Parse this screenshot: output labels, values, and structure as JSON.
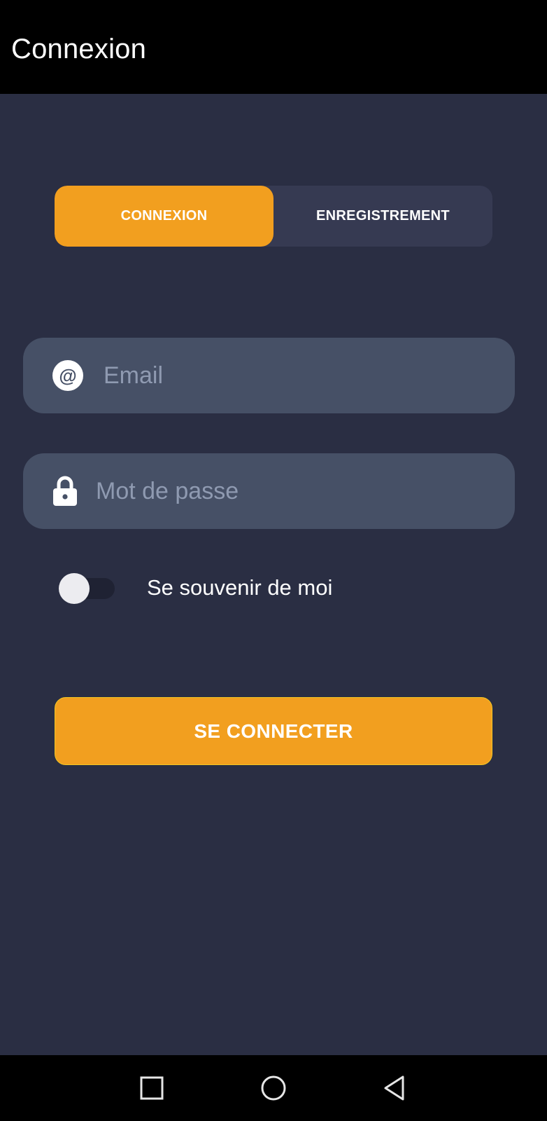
{
  "app_bar": {
    "title": "Connexion"
  },
  "tabs": [
    {
      "label": "CONNEXION",
      "active": true
    },
    {
      "label": "ENREGISTREMENT",
      "active": false
    }
  ],
  "form": {
    "email": {
      "placeholder": "Email",
      "value": "",
      "icon": "at-sign-icon"
    },
    "password": {
      "placeholder": "Mot de passe",
      "value": "",
      "icon": "lock-icon"
    },
    "remember_me": {
      "label": "Se souvenir de moi",
      "checked": false
    },
    "submit_label": "SE CONNECTER"
  },
  "nav": {
    "buttons": [
      "recents-icon",
      "home-icon",
      "back-icon"
    ]
  },
  "colors": {
    "background": "#2a2e43",
    "accent": "#f29f1f",
    "field_bg": "#465066",
    "segment_bg": "#363a52"
  }
}
